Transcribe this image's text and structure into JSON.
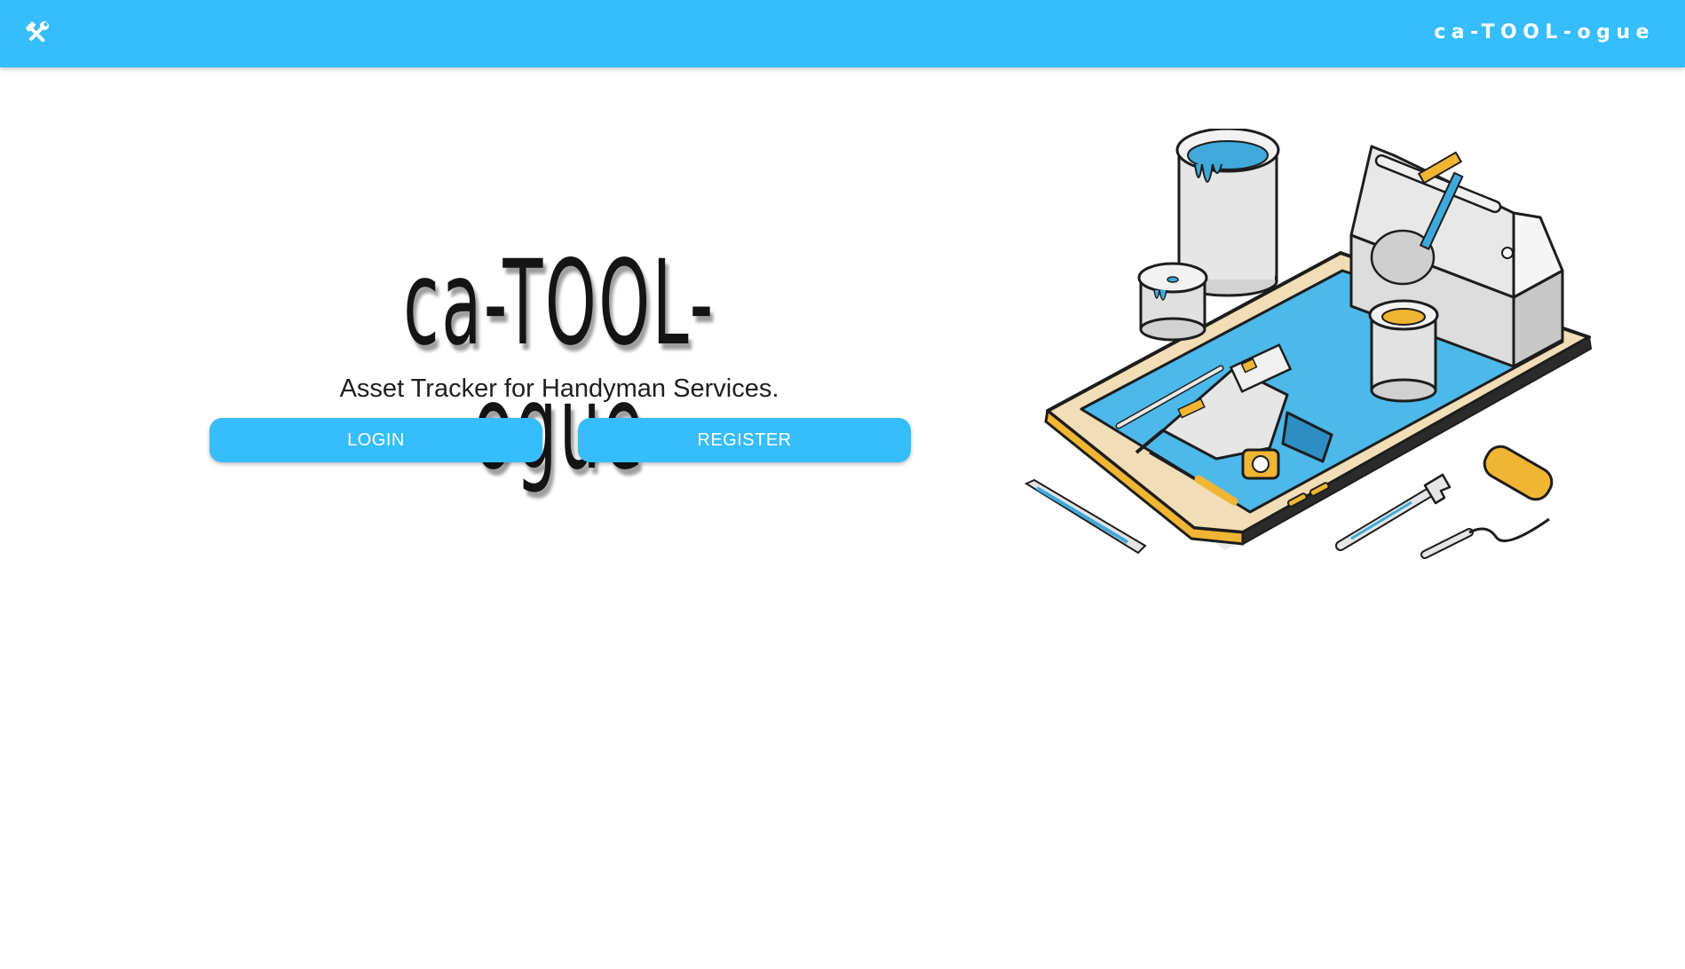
{
  "header": {
    "brand": "ca-TOOL-ogue",
    "menu_icon": "tools-icon",
    "color": "#36bdfc"
  },
  "hero": {
    "title": "ca-TOOL-ogue",
    "subtitle": "Asset Tracker for Handyman Services."
  },
  "actions": {
    "login_label": "LOGIN",
    "register_label": "REGISTER"
  },
  "illustration": {
    "icon": "isometric-toolbox-smartphone-illustration"
  }
}
